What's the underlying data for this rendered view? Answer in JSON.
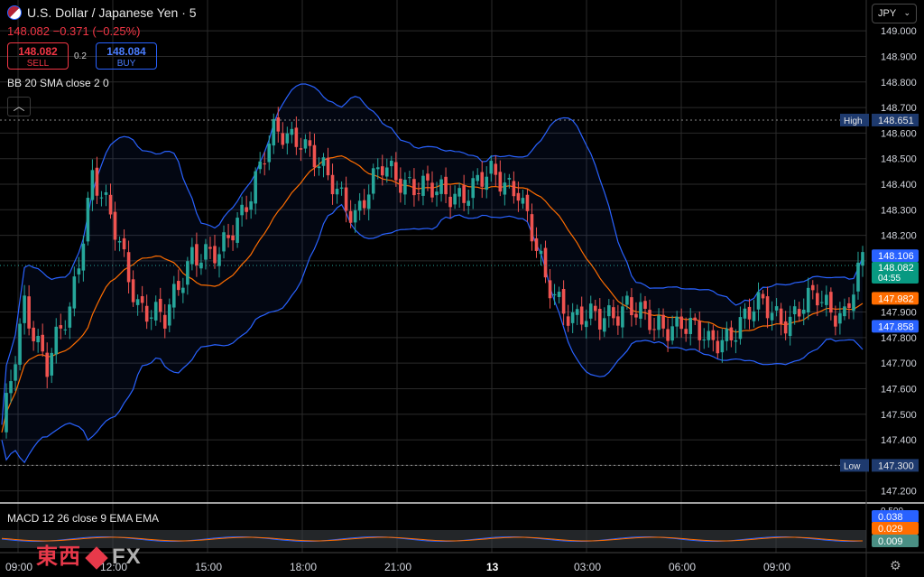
{
  "header": {
    "symbol_title": "U.S. Dollar / Japanese Yen · 5",
    "last_price": "148.082",
    "change": "−0.371 (−0.25%)",
    "sell_price": "148.082",
    "sell_label": "SELL",
    "buy_price": "148.084",
    "buy_label": "BUY",
    "spread": "0.2",
    "bb_indicator": "BB 20 SMA close 2 0",
    "currency": "JPY",
    "macd_indicator": "MACD 12 26 close 9 EMA EMA"
  },
  "colors": {
    "background": "#000000",
    "up": "#26a69a",
    "down": "#ef5350",
    "bb_band": "#2962ff",
    "bb_basis": "#ff6d00",
    "grid": "#2a2a2a",
    "high_low_tag": "#1e3a6e"
  },
  "watermark": "東西 FX",
  "chart_data": {
    "type": "candlestick",
    "title": "U.S. Dollar / Japanese Yen · 5",
    "y_ticks": [
      "149.000",
      "148.900",
      "148.800",
      "148.700",
      "148.600",
      "148.500",
      "148.400",
      "148.300",
      "148.200",
      "148.100",
      "147.900",
      "147.800",
      "147.700",
      "147.600",
      "147.500",
      "147.400",
      "147.300",
      "147.200"
    ],
    "ylim": [
      147.16,
      149.05
    ],
    "x_ticks": [
      "09:00",
      "12:00",
      "15:00",
      "18:00",
      "21:00",
      "13",
      "03:00",
      "06:00",
      "09:00"
    ],
    "high_label": "High",
    "high_value": "148.651",
    "low_label": "Low",
    "low_value": "147.300",
    "price_tags": {
      "bb_upper": "148.106",
      "last": "148.082",
      "countdown": "04:55",
      "bb_basis": "147.982",
      "bb_lower": "147.858"
    },
    "macd": {
      "top_tick": "0.500",
      "macd_value": "0.038",
      "signal_value": "0.029",
      "histogram_value": "0.009"
    },
    "price_keypoints": [
      [
        0,
        147.4
      ],
      [
        5,
        147.95
      ],
      [
        10,
        147.68
      ],
      [
        15,
        147.9
      ],
      [
        20,
        148.45
      ],
      [
        24,
        148.25
      ],
      [
        30,
        147.95
      ],
      [
        36,
        147.85
      ],
      [
        42,
        148.15
      ],
      [
        48,
        148.1
      ],
      [
        54,
        148.35
      ],
      [
        60,
        148.58
      ],
      [
        66,
        148.6
      ],
      [
        72,
        148.4
      ],
      [
        78,
        148.3
      ],
      [
        84,
        148.45
      ],
      [
        90,
        148.42
      ],
      [
        96,
        148.35
      ],
      [
        102,
        148.38
      ],
      [
        108,
        148.42
      ],
      [
        114,
        148.4
      ],
      [
        120,
        148.0
      ],
      [
        126,
        147.9
      ],
      [
        132,
        147.85
      ],
      [
        138,
        147.95
      ],
      [
        144,
        147.82
      ],
      [
        150,
        147.88
      ],
      [
        156,
        147.76
      ],
      [
        162,
        147.85
      ],
      [
        168,
        147.92
      ],
      [
        174,
        147.88
      ],
      [
        180,
        147.95
      ],
      [
        186,
        147.9
      ],
      [
        190,
        148.08
      ]
    ]
  }
}
